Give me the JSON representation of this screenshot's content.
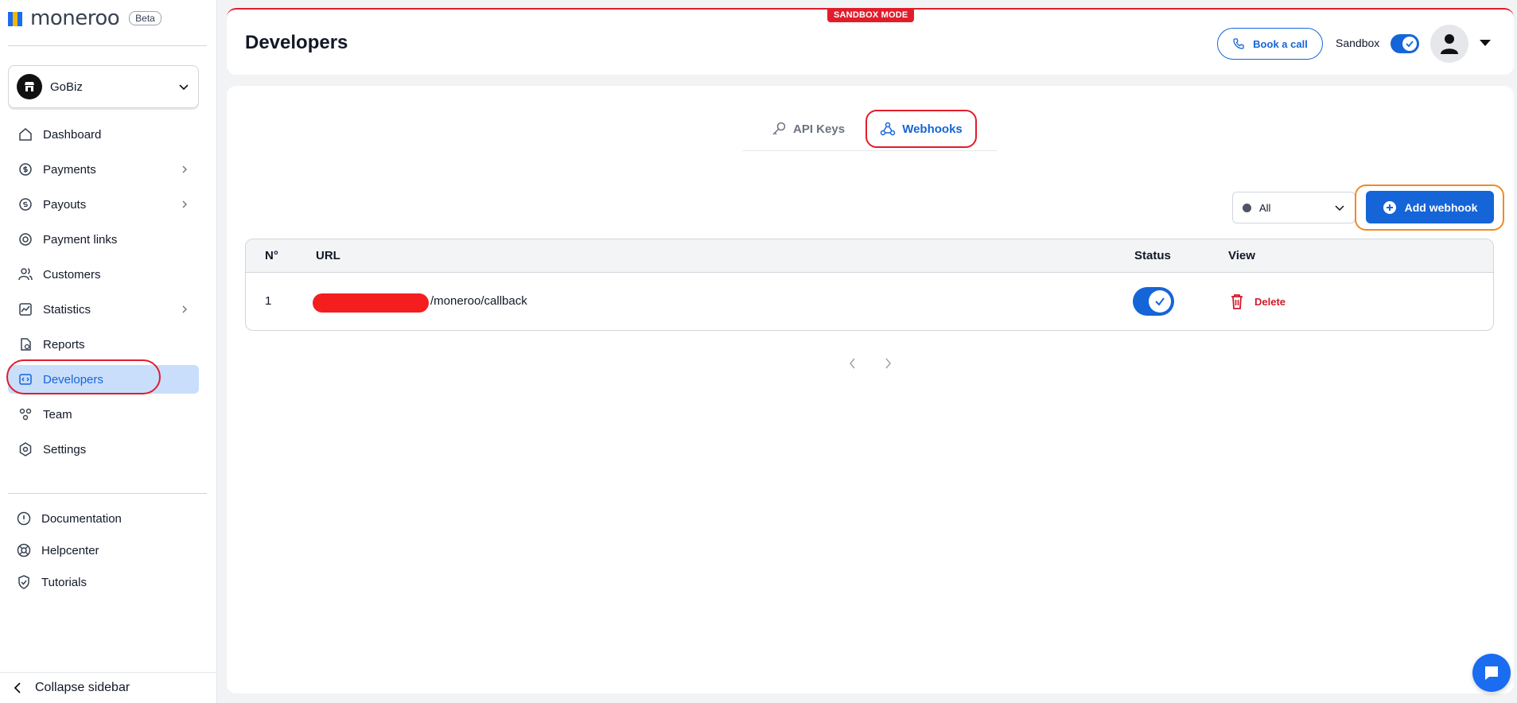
{
  "brand": {
    "name": "moneroo",
    "badge": "Beta"
  },
  "org": {
    "name": "GoBiz"
  },
  "sidebar": {
    "items": [
      {
        "label": "Dashboard",
        "icon": "home-icon",
        "chevron": false
      },
      {
        "label": "Payments",
        "icon": "payments-icon",
        "chevron": true
      },
      {
        "label": "Payouts",
        "icon": "payouts-icon",
        "chevron": true
      },
      {
        "label": "Payment links",
        "icon": "link-icon",
        "chevron": false
      },
      {
        "label": "Customers",
        "icon": "users-icon",
        "chevron": false
      },
      {
        "label": "Statistics",
        "icon": "chart-icon",
        "chevron": true
      },
      {
        "label": "Reports",
        "icon": "report-icon",
        "chevron": false
      },
      {
        "label": "Developers",
        "icon": "code-icon",
        "chevron": false,
        "active": true
      },
      {
        "label": "Team",
        "icon": "team-icon",
        "chevron": false
      },
      {
        "label": "Settings",
        "icon": "settings-icon",
        "chevron": false
      }
    ],
    "bottom": [
      {
        "label": "Documentation",
        "icon": "info-icon"
      },
      {
        "label": "Helpcenter",
        "icon": "lifebuoy-icon"
      },
      {
        "label": "Tutorials",
        "icon": "badge-check-icon"
      }
    ],
    "collapse_label": "Collapse sidebar"
  },
  "header": {
    "mode_badge": "SANDBOX MODE",
    "title": "Developers",
    "book_call": "Book a call",
    "sandbox_label": "Sandbox",
    "sandbox_on": true
  },
  "tabs": {
    "api_keys": "API Keys",
    "webhooks": "Webhooks",
    "active": "Webhooks"
  },
  "filter": {
    "selected": "All"
  },
  "add_button": "Add webhook",
  "table": {
    "columns": [
      "N°",
      "URL",
      "Status",
      "View"
    ],
    "rows": [
      {
        "n": "1",
        "url_suffix": "/moneroo/callback",
        "status_on": true,
        "action": "Delete"
      }
    ]
  },
  "colors": {
    "primary": "#1565d8",
    "danger": "#e11d2b",
    "highlight": "#f08a24"
  }
}
